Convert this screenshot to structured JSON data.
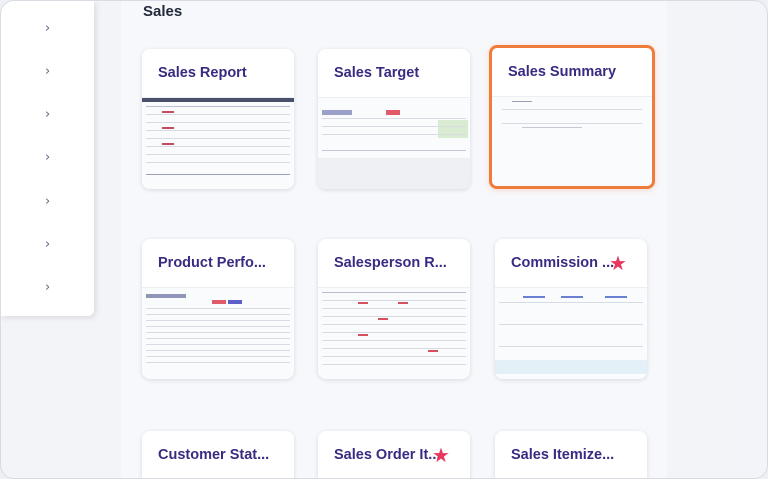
{
  "section": {
    "title": "Sales"
  },
  "sidebar": {
    "chevron_count": 7
  },
  "cards": [
    {
      "title": "Sales Report",
      "starred": false,
      "selected": false
    },
    {
      "title": "Sales Target",
      "starred": false,
      "selected": false
    },
    {
      "title": "Sales Summary",
      "starred": false,
      "selected": true
    },
    {
      "title": "Product Perfo...",
      "starred": false,
      "selected": false
    },
    {
      "title": "Salesperson R...",
      "starred": false,
      "selected": false
    },
    {
      "title": "Commission ...",
      "starred": true,
      "selected": false
    },
    {
      "title": "Customer Stat...",
      "starred": false,
      "selected": false
    },
    {
      "title": "Sales Order It...",
      "starred": true,
      "selected": false
    },
    {
      "title": "Sales Itemize...",
      "starred": false,
      "selected": false
    }
  ],
  "colors": {
    "title": "#3b2a82",
    "selected_border": "#f07c3c",
    "star": "#e8365d"
  }
}
